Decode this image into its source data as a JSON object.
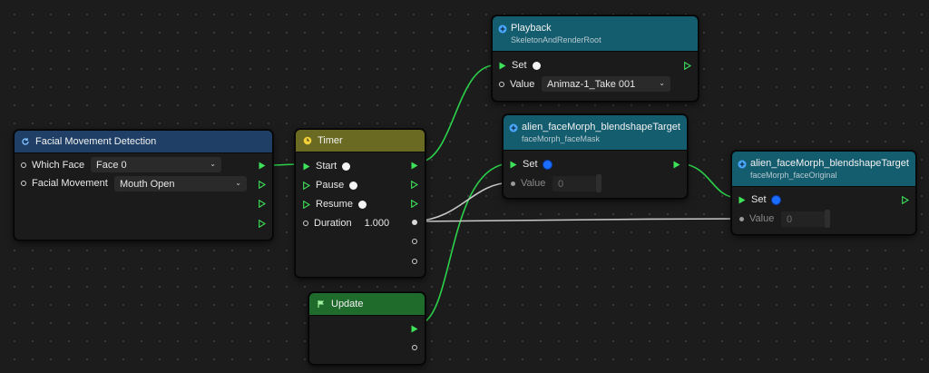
{
  "colors": {
    "wire_exec": "#2bd24a",
    "wire_value": "#c8c8c8",
    "header_blue": "#1f3f66",
    "header_teal": "#135d6e",
    "header_olive": "#6a6a22",
    "header_green": "#1f6b2c"
  },
  "nodes": {
    "facial": {
      "title": "Facial Movement Detection",
      "which_face_label": "Which Face",
      "which_face_value": "Face 0",
      "movement_label": "Facial Movement",
      "movement_value": "Mouth Open"
    },
    "timer": {
      "title": "Timer",
      "start": "Start",
      "pause": "Pause",
      "resume": "Resume",
      "duration": "Duration",
      "duration_value": "1.000"
    },
    "update": {
      "title": "Update"
    },
    "playback": {
      "title": "Playback",
      "subtitle": "SkeletonAndRenderRoot",
      "set": "Set",
      "value_label": "Value",
      "value": "Animaz-1_Take 001"
    },
    "morph_mask": {
      "title": "alien_faceMorph_blendshapeTarget",
      "subtitle": "faceMorph_faceMask",
      "set": "Set",
      "value_label": "Value",
      "value": "0"
    },
    "morph_original": {
      "title": "alien_faceMorph_blendshapeTarget",
      "subtitle": "faceMorph_faceOriginal",
      "set": "Set",
      "value_label": "Value",
      "value": "0"
    }
  },
  "icons": {
    "facial": "refresh-icon",
    "timer": "clock-icon",
    "update": "flag-icon",
    "playback": "plus-circle-icon",
    "morph": "plus-circle-icon"
  }
}
